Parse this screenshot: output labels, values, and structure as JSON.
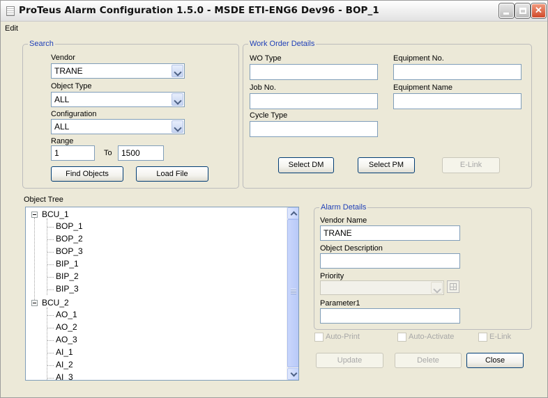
{
  "window": {
    "title": "ProTeus Alarm Configuration 1.5.0 - MSDE ETI-ENG6 Dev96 - BOP_1"
  },
  "menu": {
    "edit": "Edit"
  },
  "search": {
    "legend": "Search",
    "vendor_label": "Vendor",
    "vendor_value": "TRANE",
    "object_type_label": "Object Type",
    "object_type_value": "ALL",
    "configuration_label": "Configuration",
    "configuration_value": "ALL",
    "range_label": "Range",
    "range_from": "1",
    "range_to_label": "To",
    "range_to": "1500",
    "find_objects": "Find Objects",
    "load_file": "Load File"
  },
  "work_order": {
    "legend": "Work Order Details",
    "wo_type_label": "WO Type",
    "wo_type_value": "",
    "equipment_no_label": "Equipment No.",
    "equipment_no_value": "",
    "job_no_label": "Job No.",
    "job_no_value": "",
    "equipment_name_label": "Equipment Name",
    "equipment_name_value": "",
    "cycle_type_label": "Cycle Type",
    "cycle_type_value": "",
    "select_dm": "Select DM",
    "select_pm": "Select PM",
    "e_link": "E-Link"
  },
  "object_tree": {
    "label": "Object Tree",
    "nodes": [
      {
        "label": "BCU_1",
        "children": [
          "BOP_1",
          "BOP_2",
          "BOP_3",
          "BIP_1",
          "BIP_2",
          "BIP_3"
        ]
      },
      {
        "label": "BCU_2",
        "children": [
          "AO_1",
          "AO_2",
          "AO_3",
          "AI_1",
          "AI_2",
          "AI_3"
        ]
      }
    ]
  },
  "alarm": {
    "legend": "Alarm Details",
    "vendor_name_label": "Vendor Name",
    "vendor_name_value": "TRANE",
    "object_description_label": "Object Description",
    "object_description_value": "",
    "priority_label": "Priority",
    "priority_value": "",
    "parameter1_label": "Parameter1",
    "parameter1_value": ""
  },
  "options": {
    "auto_print": "Auto-Print",
    "auto_activate": "Auto-Activate",
    "e_link": "E-Link"
  },
  "actions": {
    "update": "Update",
    "delete": "Delete",
    "close": "Close"
  }
}
